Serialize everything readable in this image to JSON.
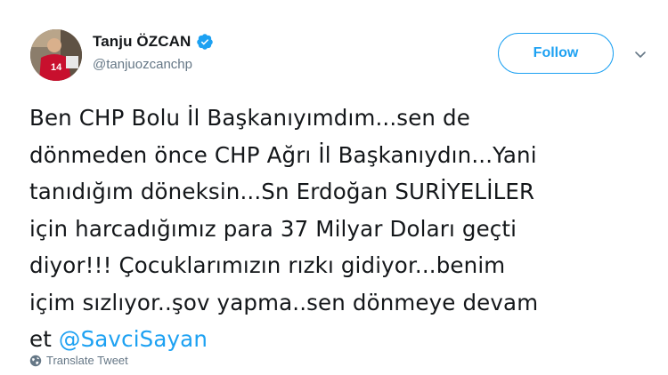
{
  "author": {
    "display_name": "Tanju ÖZCAN",
    "handle": "@tanjuozcanchp",
    "verified": true,
    "avatar_jersey_number": "14"
  },
  "follow_button": {
    "label": "Follow"
  },
  "tweet": {
    "lines": [
      "Ben CHP Bolu İl Başkanıyımdım...sen de",
      "dönmeden önce CHP Ağrı İl Başkanıydın...Yani",
      "tanıdığım döneksin...Sn Erdoğan SURİYELİLER",
      "için harcadığımız para 37 Milyar Doları geçti",
      "diyor!!! Çocuklarımızın rızkı gidiyor...benim",
      "içim sızlıyor..şov yapma..sen dönmeye devam"
    ],
    "last_line_prefix": "et ",
    "mention": "@SavciSayan"
  },
  "translate": {
    "label": "Translate Tweet",
    "icon": "globe-icon"
  },
  "menu": {
    "icon": "chevron-down-icon"
  },
  "colors": {
    "brand_blue": "#1da1f2",
    "text_primary": "#14171a",
    "text_secondary": "#657786"
  }
}
